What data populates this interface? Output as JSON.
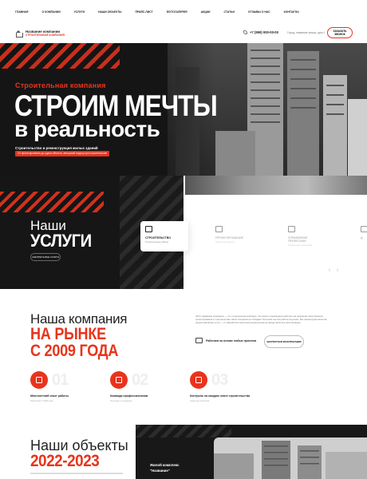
{
  "nav": {
    "items": [
      "Главная",
      "О компании",
      "Услуги",
      "Наши объекты",
      "Прайс-лист",
      "Фотогалерея",
      "Акции",
      "Статьи",
      "Отзывы о нас",
      "Контакты"
    ]
  },
  "header": {
    "company_name": "Название компании",
    "company_sub": "Строительная компания",
    "phone": "+7 (999) 000-00-00",
    "address": "Город, название улицы, дом 1",
    "callback_label": "Заказать звонок"
  },
  "hero": {
    "kicker": "Строительная компания",
    "title_line1": "СТРОИМ МЕЧТЫ",
    "title_line2": "в реальность",
    "subtitle": "Строительство и реконструкция жилых зданий",
    "tag": "От проектирования до сдачи объекта, авторский надзор при строительстве"
  },
  "services": {
    "title_line1": "Наши",
    "title_line2": "УСЛУГИ",
    "all_services_label": "Смотреть все услуги",
    "cards": [
      {
        "title": "Строительство",
        "subtitle": "Строительные работы"
      },
      {
        "title": "Проектирование",
        "subtitle": "Проектные работы"
      },
      {
        "title": "Управление проектами",
        "subtitle": "Управление проектами"
      },
      {
        "title": "Д",
        "subtitle": ""
      }
    ],
    "prev_arrow": "‹",
    "next_arrow": "›"
  },
  "company": {
    "title_line1": "Наша компания",
    "title_line2": "НА РЫНКЕ",
    "title_line3": "С 2009 ГОДА",
    "text": "ООО «Название компании» — это строительная компания, постоянно стремящаяся работать на принципах качественного проектирования и строительства. Наши специалисты обладают большим опытом работы на рынке. Мы гарантируем качество предоставляемых услуг — от разработки проектной документации до ввода объекта в эксплуатацию.",
    "feature": "Работаем на основе любых проектов",
    "consult_label": "Бесплатная консультация",
    "stats": [
      {
        "num": "01",
        "title": "Многолетний опыт работы",
        "sub": "Работаем с 2009 года"
      },
      {
        "num": "02",
        "title": "Команда профессионалов",
        "sub": "Опытные сотрудники"
      },
      {
        "num": "03",
        "title": "Контроль на каждом этапе строительства",
        "sub": "Гарантия качества"
      }
    ]
  },
  "objects": {
    "title_line1": "Наши объекты",
    "title_line2": "2022-2023",
    "item_line1": "Жилой комплекс",
    "item_line2": "\"Название\""
  },
  "colors": {
    "accent": "#e8341c",
    "dark": "#151515"
  }
}
